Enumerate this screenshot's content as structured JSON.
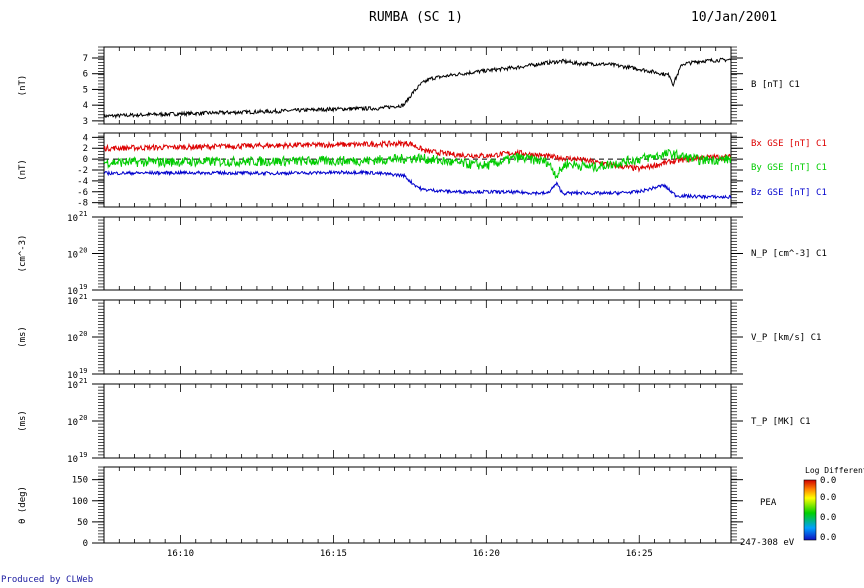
{
  "header": {
    "title": "RUMBA (SC 1)",
    "date": "10/Jan/2001"
  },
  "footer": {
    "credit": "Produced by CLWeb"
  },
  "time_axis": {
    "start_min": 967.5,
    "end_min": 988.0,
    "ticks": [
      {
        "min": 970,
        "label": "16:10"
      },
      {
        "min": 975,
        "label": "16:15"
      },
      {
        "min": 980,
        "label": "16:20"
      },
      {
        "min": 985,
        "label": "16:25"
      }
    ]
  },
  "colorbar": {
    "title": "Log Differential",
    "labels": [
      "0.0",
      "0.0",
      "0.0",
      "0.0"
    ],
    "energy_label": "247-308 eV"
  },
  "chart_data": [
    {
      "type": "line",
      "ylabel": "(nT)",
      "ylim": [
        2.8,
        7.7
      ],
      "yticks": [
        "3",
        "4",
        "5",
        "6",
        "7"
      ],
      "ytick_values": [
        3,
        4,
        5,
        6,
        7
      ],
      "series": [
        {
          "name": "B [nT] C1",
          "color": "#000000",
          "noise": 0.12,
          "x": [
            967.5,
            969.0,
            971.0,
            973.0,
            975.0,
            976.5,
            977.3,
            977.6,
            977.9,
            978.2,
            979.0,
            980.0,
            981.0,
            982.0,
            982.5,
            983.0,
            984.0,
            985.0,
            986.0,
            986.1,
            986.4,
            987.0,
            988.0
          ],
          "y": [
            3.3,
            3.4,
            3.5,
            3.6,
            3.75,
            3.8,
            4.0,
            4.8,
            5.4,
            5.7,
            5.95,
            6.2,
            6.4,
            6.7,
            6.8,
            6.65,
            6.6,
            6.3,
            5.9,
            5.3,
            6.6,
            6.8,
            6.9
          ]
        }
      ]
    },
    {
      "type": "line",
      "ylabel": "(nT)",
      "ylim": [
        -8.8,
        4.8
      ],
      "yticks": [
        "4",
        "2",
        "0",
        "-2",
        "-4",
        "-6",
        "-8"
      ],
      "ytick_values": [
        4,
        2,
        0,
        -2,
        -4,
        -6,
        -8
      ],
      "zero_line": true,
      "series": [
        {
          "name": "Bx GSE [nT] C1",
          "color": "#dd0000",
          "noise": 0.5,
          "x": [
            967.5,
            970.0,
            973.0,
            976.0,
            977.5,
            978.0,
            979.0,
            980.0,
            981.0,
            982.0,
            982.5,
            983.0,
            984.0,
            985.0,
            986.0,
            987.0,
            988.0
          ],
          "y": [
            2.0,
            2.2,
            2.5,
            2.7,
            2.9,
            1.5,
            0.8,
            0.6,
            1.2,
            0.5,
            0.2,
            0.0,
            -1.0,
            -1.8,
            -0.5,
            0.3,
            0.4
          ]
        },
        {
          "name": "By GSE [nT] C1",
          "color": "#00cc00",
          "noise": 0.9,
          "x": [
            967.5,
            970.0,
            973.0,
            976.0,
            977.0,
            977.8,
            979.0,
            980.0,
            981.0,
            982.0,
            982.3,
            982.6,
            983.5,
            985.0,
            986.0,
            987.0,
            988.0
          ],
          "y": [
            -0.6,
            -0.5,
            -0.4,
            -0.3,
            0.0,
            0.2,
            -0.7,
            -1.2,
            0.3,
            -0.5,
            -3.0,
            -0.8,
            -1.5,
            0.0,
            1.0,
            -0.2,
            0.0
          ]
        },
        {
          "name": "Bz GSE [nT] C1",
          "color": "#0000cc",
          "noise": 0.3,
          "x": [
            967.5,
            970.0,
            973.0,
            976.0,
            977.3,
            977.6,
            977.9,
            979.0,
            980.0,
            981.0,
            982.0,
            982.3,
            982.5,
            983.0,
            984.0,
            985.0,
            985.8,
            986.2,
            987.0,
            988.0
          ],
          "y": [
            -2.6,
            -2.5,
            -2.6,
            -2.4,
            -3.0,
            -4.5,
            -5.6,
            -6.0,
            -6.0,
            -6.1,
            -6.3,
            -4.5,
            -6.3,
            -6.2,
            -6.3,
            -6.0,
            -4.8,
            -6.7,
            -6.9,
            -7.0
          ]
        }
      ]
    },
    {
      "type": "line",
      "ylabel": "(cm^-3)",
      "yticks": [
        "10",
        "10",
        "10"
      ],
      "ytick_exponents": [
        "21",
        "20",
        "19"
      ],
      "scale": "log",
      "series": [
        {
          "name": "N_P [cm^-3] C1",
          "color": "#000000"
        }
      ]
    },
    {
      "type": "line",
      "ylabel": "(ms)",
      "yticks": [
        "10",
        "10",
        "10"
      ],
      "ytick_exponents": [
        "21",
        "20",
        "19"
      ],
      "scale": "log",
      "series": [
        {
          "name": "V_P [km/s] C1",
          "color": "#000000"
        }
      ]
    },
    {
      "type": "line",
      "ylabel": "(ms)",
      "yticks": [
        "10",
        "10",
        "10"
      ],
      "ytick_exponents": [
        "21",
        "20",
        "19"
      ],
      "scale": "log",
      "series": [
        {
          "name": "T_P [MK] C1",
          "color": "#000000"
        }
      ]
    },
    {
      "type": "heatmap",
      "ylabel": "θ (deg)",
      "ylim": [
        0,
        180
      ],
      "yticks": [
        "150",
        "100",
        "50",
        "0"
      ],
      "ytick_values": [
        150,
        100,
        50,
        0
      ],
      "series": [
        {
          "name": "PEA",
          "color": "#000000"
        }
      ]
    }
  ]
}
